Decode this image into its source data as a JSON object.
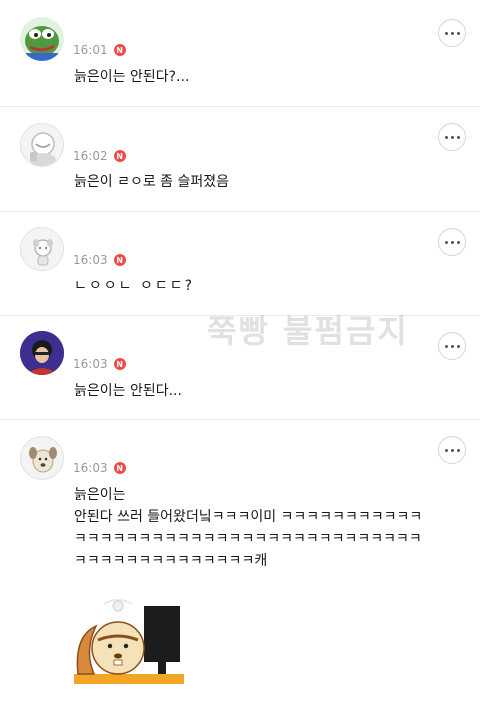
{
  "comments": [
    {
      "time": "16:01",
      "badge": "N",
      "text": "늙은이는 안된다?..."
    },
    {
      "time": "16:02",
      "badge": "N",
      "text": "늙은이 ㄹㅇ로 좀 슬퍼졌음"
    },
    {
      "time": "16:03",
      "badge": "N",
      "text": "ㄴㅇㅇㄴ ㅇㄷㄷ?"
    },
    {
      "time": "16:03",
      "badge": "N",
      "text": "늙은이는 안된다..."
    },
    {
      "time": "16:03",
      "badge": "N",
      "text": "늙은이는\n안된다 쓰러 들어왔더닠ㅋㅋㅋ이미 ㅋㅋㅋㅋㅋㅋㅋㅋㅋㅋㅋ\nㅋㅋㅋㅋㅋㅋㅋㅋㅋㅋㅋㅋㅋㅋㅋㅋㅋㅋㅋㅋㅋㅋㅋㅋㅋㅋㅋ\nㅋㅋㅋㅋㅋㅋㅋㅋㅋㅋㅋㅋㅋㅋ캐"
    }
  ],
  "watermark": "쭉빵 불펌금지",
  "colors": {
    "badge": "#ef4a4a",
    "time": "#9a9a9a",
    "divider": "#ececec"
  },
  "icons": [
    "frog-avatar-icon",
    "cartoon-avatar-icon",
    "dog-sketch-avatar-icon",
    "person-avatar-icon",
    "dog-avatar-icon",
    "more-options-icon",
    "squirrel-computer-sticker"
  ]
}
